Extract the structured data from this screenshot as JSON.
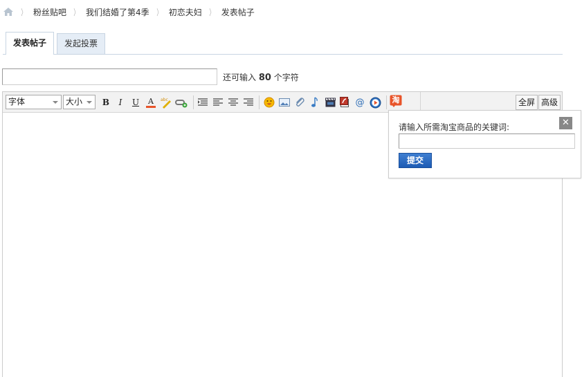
{
  "breadcrumb": {
    "items": [
      "粉丝贴吧",
      "我们结婚了第4季",
      "初恋夫妇",
      "发表帖子"
    ],
    "separator": "〉"
  },
  "tabs": [
    {
      "label": "发表帖子",
      "active": true
    },
    {
      "label": "发起投票",
      "active": false
    }
  ],
  "title_field": {
    "value": "",
    "placeholder": "",
    "hint_prefix": "还可输入",
    "hint_count": "80",
    "hint_suffix": "个字符"
  },
  "toolbar": {
    "font_select": "字体",
    "size_select": "大小",
    "bold": "B",
    "italic": "I",
    "underline": "U",
    "font_color": "A",
    "spellcheck": "abc",
    "fullscreen": "全屏",
    "advanced": "高级",
    "taobao": "淘",
    "at": "@"
  },
  "taobao_popup": {
    "label": "请输入所需淘宝商品的关键词:",
    "input_value": "",
    "submit_label": "提交",
    "close_symbol": "✕"
  },
  "colors": {
    "tab_border": "#c7d4e2",
    "tab_inactive_bg": "#e5edf6",
    "toolbar_bg": "#f2f2f2",
    "submit_blue": "#1c5bb4",
    "taobao_orange": "#e8542a"
  }
}
